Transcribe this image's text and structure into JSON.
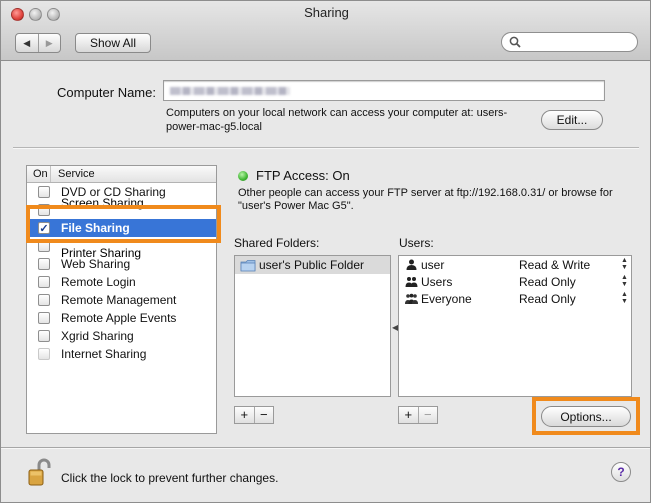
{
  "window": {
    "title": "Sharing"
  },
  "toolbar": {
    "back_icon": "left-triangle-icon",
    "forward_icon": "right-triangle-icon",
    "show_all_label": "Show All",
    "search_placeholder": ""
  },
  "computer_name": {
    "label": "Computer Name:",
    "value": "",
    "description": "Computers on your local network can access your computer at: users-power-mac-g5.local",
    "edit_label": "Edit..."
  },
  "services": {
    "header_on": "On",
    "header_service": "Service",
    "items": [
      {
        "label": "DVD or CD Sharing",
        "checked": false
      },
      {
        "label": "Screen Sharing",
        "checked": false
      },
      {
        "label": "File Sharing",
        "checked": true,
        "selected": true
      },
      {
        "label": "Printer Sharing",
        "checked": false
      },
      {
        "label": "Web Sharing",
        "checked": false
      },
      {
        "label": "Remote Login",
        "checked": false
      },
      {
        "label": "Remote Management",
        "checked": false
      },
      {
        "label": "Remote Apple Events",
        "checked": false
      },
      {
        "label": "Xgrid Sharing",
        "checked": false
      },
      {
        "label": "Internet Sharing",
        "checked": false,
        "disabled": true
      }
    ]
  },
  "ftp": {
    "status": "FTP Access: On",
    "description": "Other people can access your FTP server at ftp://192.168.0.31/ or browse for \"user's Power Mac G5\"."
  },
  "shared_folders": {
    "label": "Shared Folders:",
    "items": [
      "user's Public Folder"
    ],
    "add_label": "+",
    "remove_label": "−"
  },
  "users": {
    "label": "Users:",
    "items": [
      {
        "name": "user",
        "permission": "Read & Write",
        "icon": "single-user-icon"
      },
      {
        "name": "Users",
        "permission": "Read Only",
        "icon": "group-icon"
      },
      {
        "name": "Everyone",
        "permission": "Read Only",
        "icon": "everyone-group-icon"
      }
    ],
    "add_label": "+",
    "remove_label": "−"
  },
  "options_label": "Options...",
  "footer": {
    "lock_text": "Click the lock to prevent further changes.",
    "help_label": "?"
  },
  "colors": {
    "selection": "#3875d7",
    "highlight": "#f08a1c",
    "status_green": "#3fb532"
  }
}
